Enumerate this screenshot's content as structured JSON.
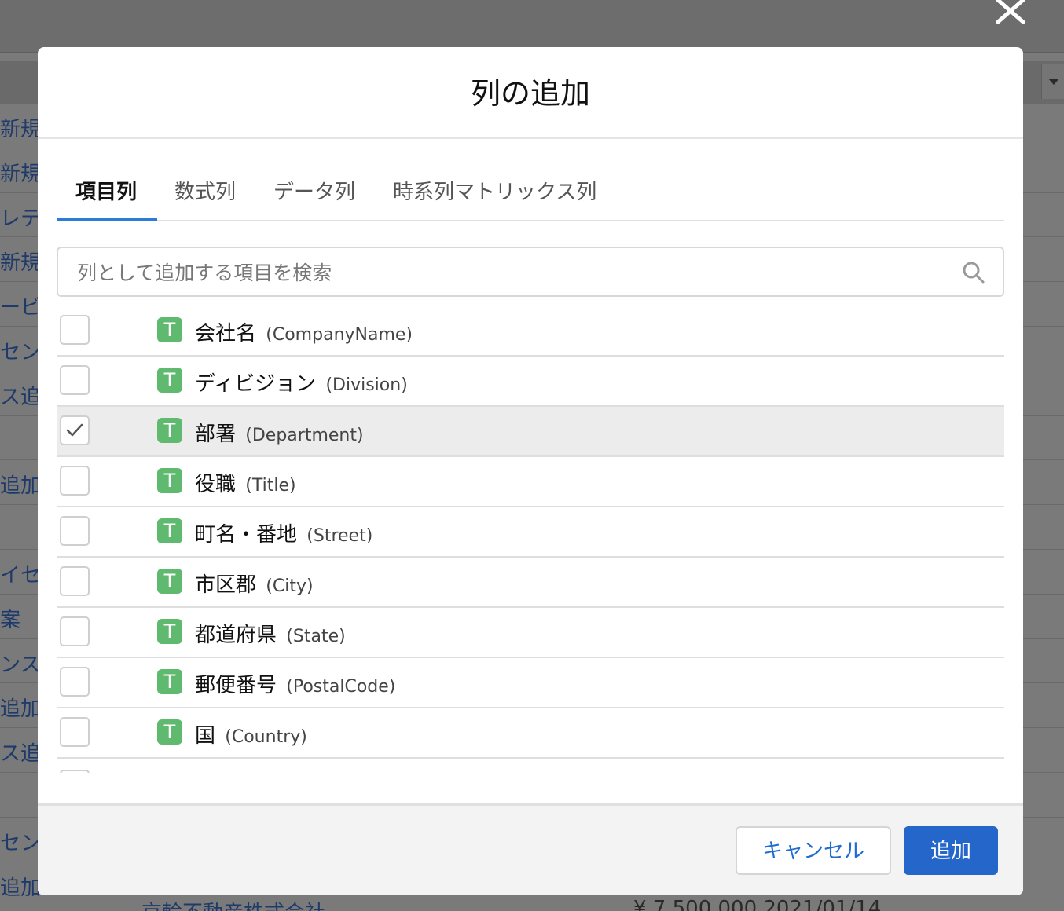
{
  "background": {
    "rows": [
      "新規",
      "新規",
      "レティ",
      "新規扌",
      "ービス",
      "センフ",
      "ス追加",
      "",
      "追加",
      "",
      "イセ",
      "案",
      "ンス",
      "追加扌",
      "ス追加",
      "",
      "セン",
      "追加"
    ],
    "bottom_text": "京輪不動産株式会社",
    "bottom_num": "¥ 7,500,000 2021/01/14"
  },
  "modal": {
    "title": "列の追加",
    "tabs": [
      {
        "label": "項目列",
        "active": true
      },
      {
        "label": "数式列",
        "active": false
      },
      {
        "label": "データ列",
        "active": false
      },
      {
        "label": "時系列マトリックス列",
        "active": false
      }
    ],
    "search": {
      "placeholder": "列として追加する項目を検索",
      "value": ""
    },
    "items": [
      {
        "type": "T",
        "label": "会社名",
        "api": "(CompanyName)",
        "checked": false
      },
      {
        "type": "T",
        "label": "ディビジョン",
        "api": "(Division)",
        "checked": false
      },
      {
        "type": "T",
        "label": "部署",
        "api": "(Department)",
        "checked": true
      },
      {
        "type": "T",
        "label": "役職",
        "api": "(Title)",
        "checked": false
      },
      {
        "type": "T",
        "label": "町名・番地",
        "api": "(Street)",
        "checked": false
      },
      {
        "type": "T",
        "label": "市区郡",
        "api": "(City)",
        "checked": false
      },
      {
        "type": "T",
        "label": "都道府県",
        "api": "(State)",
        "checked": false
      },
      {
        "type": "T",
        "label": "郵便番号",
        "api": "(PostalCode)",
        "checked": false
      },
      {
        "type": "T",
        "label": "国",
        "api": "(Country)",
        "checked": false
      }
    ],
    "footer": {
      "cancel_label": "キャンセル",
      "add_label": "追加"
    }
  },
  "colors": {
    "accent": "#2466c9",
    "badge_text_type": "#5fba6f",
    "tab_underline": "#2e7bd6"
  }
}
